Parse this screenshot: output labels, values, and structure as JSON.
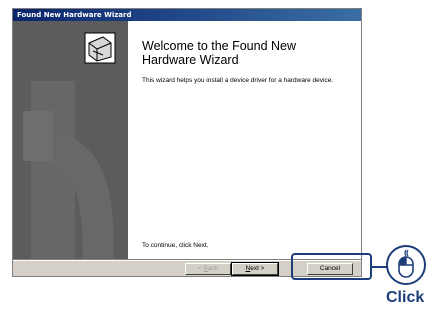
{
  "window": {
    "title": "Found New Hardware Wizard"
  },
  "content": {
    "heading": "Welcome to the Found New Hardware Wizard",
    "description": "This wizard helps you install a device driver for a hardware device.",
    "continue_text": "To continue, click Next."
  },
  "buttons": {
    "back": {
      "prefix": "< ",
      "mnemonic": "B",
      "rest": "ack"
    },
    "next": {
      "mnemonic": "N",
      "rest": "ext >"
    },
    "cancel": "Cancel"
  },
  "callout": {
    "label": "Click",
    "icon": "mouse-icon",
    "color": "#1d3e7a"
  }
}
